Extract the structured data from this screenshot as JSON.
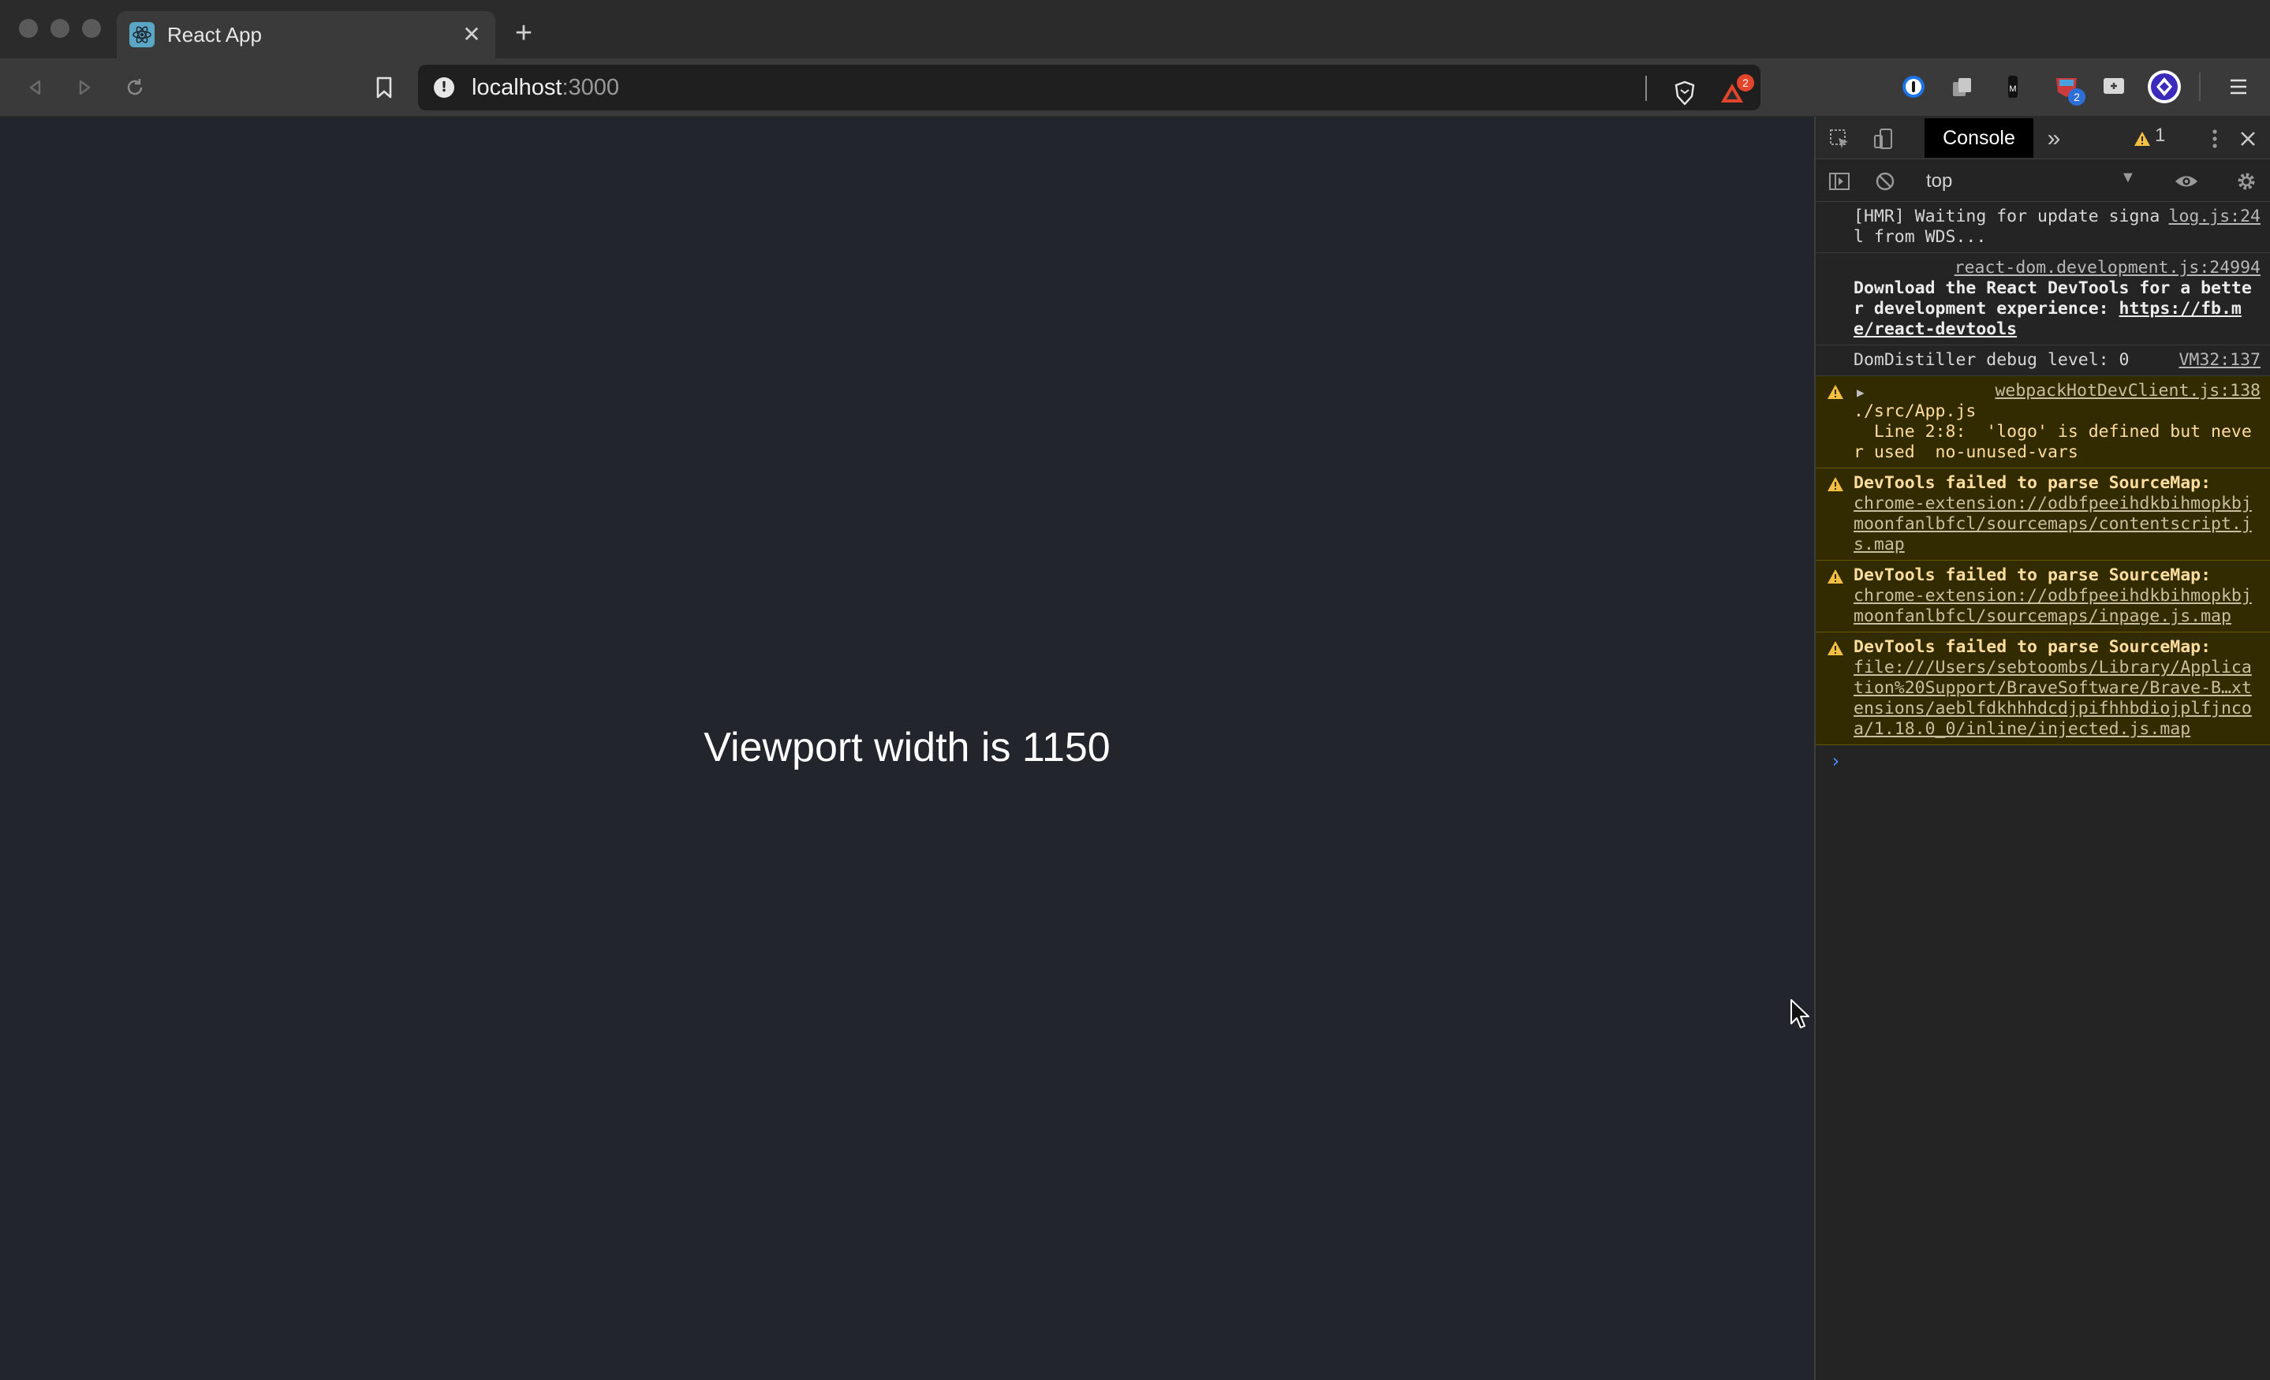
{
  "browser": {
    "tab": {
      "title": "React App",
      "close_glyph": "✕"
    },
    "new_tab_glyph": "+",
    "address": {
      "host": "localhost",
      "port": ":3000"
    },
    "extensions": {
      "brave_shield_badge": "",
      "rewards_badge": "2",
      "ext_badge": "2"
    }
  },
  "page": {
    "text": "Viewport width is 1150"
  },
  "devtools": {
    "active_tab": "Console",
    "more_tabs_glyph": "»",
    "warning_count": "1",
    "context": "top",
    "messages": [
      {
        "type": "log",
        "text": "[HMR] Waiting for update signal from WDS...",
        "source": "log.js:24"
      },
      {
        "type": "log",
        "source": "react-dom.development.js:24994",
        "bold_text": "Download the React DevTools for a better development experience: ",
        "link": "https://fb.me/react-devtools"
      },
      {
        "type": "log",
        "text": "DomDistiller debug level: 0",
        "source": "VM32:137"
      },
      {
        "type": "warn",
        "source": "webpackHotDevClient.js:138",
        "text": "./src/App.js\n  Line 2:8:  'logo' is defined but never used  no-unused-vars"
      },
      {
        "type": "warn",
        "bold_text": "DevTools failed to parse SourceMap:",
        "link": "chrome-extension://odbfpeeihdkbihmopkbjmoonfanlbfcl/sourcemaps/contentscript.js.map"
      },
      {
        "type": "warn",
        "bold_text": "DevTools failed to parse SourceMap:",
        "link": "chrome-extension://odbfpeeihdkbihmopkbjmoonfanlbfcl/sourcemaps/inpage.js.map"
      },
      {
        "type": "warn",
        "bold_text": "DevTools failed to parse SourceMap:",
        "link": "file:///Users/sebtoombs/Library/Application%20Support/BraveSoftware/Brave-B…xtensions/aeblfdkhhhdcdjpifhhbdiojplfjncoa/1.18.0_0/inline/injected.js.map"
      }
    ],
    "prompt_glyph": "›"
  },
  "colors": {
    "page_bg": "#22252c",
    "devtools_bg": "#242424",
    "warn_bg": "#332b00",
    "warn_text": "#ffdd9e",
    "accent": "#4c8dff"
  }
}
